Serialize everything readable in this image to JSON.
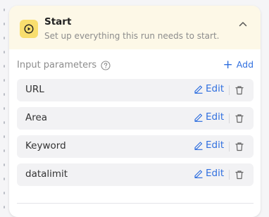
{
  "node": {
    "title": "Start",
    "subtitle": "Set up everything this run needs to start.",
    "icon": "play-circle-icon",
    "collapse_icon": "chevron-up-icon",
    "accent_color": "#f8de6e",
    "header_bg": "#fdf8e7"
  },
  "input_parameters": {
    "label": "Input parameters",
    "help_icon": "question-circle-icon",
    "add_label": "Add",
    "add_icon": "plus-icon",
    "link_color": "#2f6fdf",
    "items": [
      {
        "name": "URL",
        "edit_label": "Edit"
      },
      {
        "name": "Area",
        "edit_label": "Edit"
      },
      {
        "name": "Keyword",
        "edit_label": "Edit"
      },
      {
        "name": "datalimit",
        "edit_label": "Edit"
      }
    ]
  }
}
